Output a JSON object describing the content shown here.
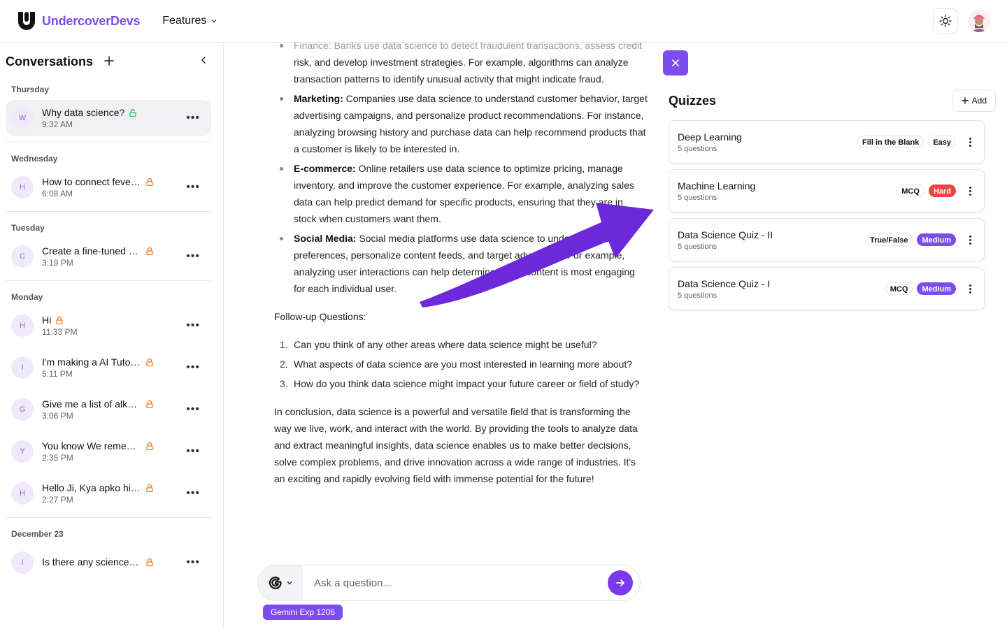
{
  "header": {
    "brand": "UndercoverDevs",
    "features_label": "Features"
  },
  "sidebar": {
    "title": "Conversations",
    "groups": [
      {
        "label": "Thursday",
        "items": [
          {
            "initial": "W",
            "title": "Why data science?",
            "time": "9:32 AM",
            "lock": "open"
          }
        ]
      },
      {
        "label": "Wednesday",
        "items": [
          {
            "initial": "H",
            "title": "How to connect fever a...",
            "time": "6:08 AM",
            "lock": "locked"
          }
        ]
      },
      {
        "label": "Tuesday",
        "items": [
          {
            "initial": "C",
            "title": "Create a fine-tuned mo...",
            "time": "3:19 PM",
            "lock": "locked"
          }
        ]
      },
      {
        "label": "Monday",
        "items": [
          {
            "initial": "H",
            "title": "Hi",
            "time": "11:33 PM",
            "lock": "locked"
          },
          {
            "initial": "I",
            "title": "I'm making a AI Tutor, ...",
            "time": "5:11 PM",
            "lock": "locked"
          },
          {
            "initial": "G",
            "title": "Give me a list of alkane ...",
            "time": "3:06 PM",
            "lock": "locked"
          },
          {
            "initial": "Y",
            "title": "You know We remembe...",
            "time": "2:35 PM",
            "lock": "locked"
          },
          {
            "initial": "H",
            "title": "Hello Ji, Kya apko hindi ...",
            "time": "2:27 PM",
            "lock": "locked"
          }
        ]
      },
      {
        "label": "December 23",
        "items": [
          {
            "initial": "I",
            "title": "Is there any science beh...",
            "time": "",
            "lock": "locked"
          }
        ]
      }
    ]
  },
  "chat": {
    "finance_tail": "risk, and develop investment strategies. For example, algorithms can analyze transaction patterns to identify unusual activity that might indicate fraud.",
    "finance_faded_top": "Finance: Banks use data science to detect fraudulent transactions, assess credit",
    "bullets": [
      {
        "label": "Marketing:",
        "text": " Companies use data science to understand customer behavior, target advertising campaigns, and personalize product recommendations. For instance, analyzing browsing history and purchase data can help recommend products that a customer is likely to be interested in."
      },
      {
        "label": "E-commerce:",
        "text": " Online retailers use data science to optimize pricing, manage inventory, and improve the customer experience. For example, analyzing sales data can help predict demand for specific products, ensuring that they are in stock when customers want them."
      },
      {
        "label": "Social Media:",
        "text": " Social media platforms use data science to understand user preferences, personalize content feeds, and target advertising. For example, analyzing user interactions can help determine which content is most engaging for each individual user."
      }
    ],
    "followup_heading": "Follow-up Questions:",
    "followups": [
      {
        "num": "1.",
        "text": "Can you think of any other areas where data science might be useful?"
      },
      {
        "num": "2.",
        "text": "What aspects of data science are you most interested in learning more about?"
      },
      {
        "num": "3.",
        "text": "How do you think data science might impact your future career or field of study?"
      }
    ],
    "conclusion": "In conclusion, data science is a powerful and versatile field that is transforming the way we live, work, and interact with the world. By providing the tools to analyze data and extract meaningful insights, data science enables us to make better decisions, solve complex problems, and drive innovation across a wide range of industries. It's an exciting and rapidly evolving field with immense potential for the future!"
  },
  "composer": {
    "placeholder": "Ask a question...",
    "model": "Gemini Exp 1206"
  },
  "quizzes": {
    "title": "Quizzes",
    "add_label": "Add",
    "items": [
      {
        "name": "Deep Learning",
        "count": "5 questions",
        "type": "Fill in the Blank",
        "difficulty": "Easy",
        "diff_bg": "#ffffff",
        "diff_fg": "#111111",
        "diff_border": "#e6e6ea"
      },
      {
        "name": "Machine Learning",
        "count": "5 questions",
        "type": "MCQ",
        "difficulty": "Hard",
        "diff_bg": "#ef4444",
        "diff_fg": "#ffffff",
        "diff_border": "#ef4444"
      },
      {
        "name": "Data Science Quiz - II",
        "count": "5 questions",
        "type": "True/False",
        "difficulty": "Medium",
        "diff_bg": "#7c4dec",
        "diff_fg": "#ffffff",
        "diff_border": "#7c4dec"
      },
      {
        "name": "Data Science Quiz - I",
        "count": "5 questions",
        "type": "MCQ",
        "difficulty": "Medium",
        "diff_bg": "#7c4dec",
        "diff_fg": "#ffffff",
        "diff_border": "#7c4dec"
      }
    ]
  },
  "colors": {
    "accent": "#7c4dec",
    "lock_open": "#22c55e",
    "lock_locked": "#f97316"
  }
}
